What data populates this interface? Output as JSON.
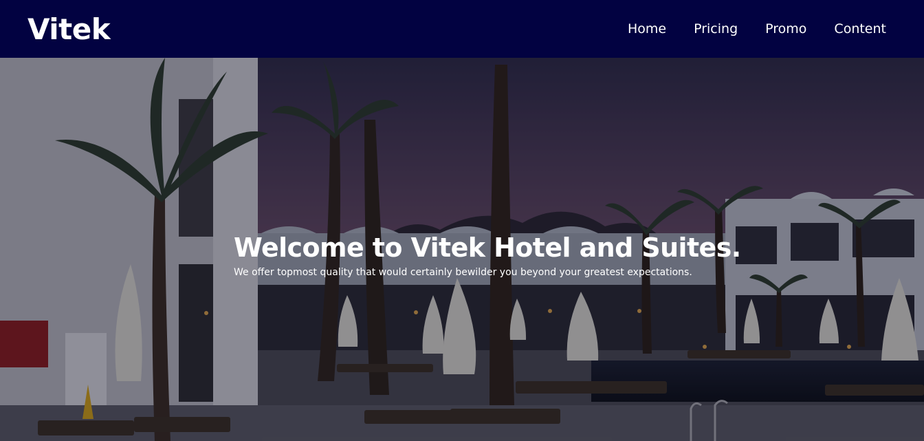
{
  "header": {
    "brand": "Vitek",
    "nav": [
      {
        "label": "Home"
      },
      {
        "label": "Pricing"
      },
      {
        "label": "Promo"
      },
      {
        "label": "Content"
      }
    ]
  },
  "hero": {
    "title": "Welcome to Vitek Hotel and Suites.",
    "subtitle": "We offer topmost quality that would certainly bewilder you beyond your greatest expectations.",
    "background_colors": {
      "sky_top": "#3a3454",
      "sky_bottom": "#7a5a72",
      "ground": "#3c3c44"
    }
  }
}
